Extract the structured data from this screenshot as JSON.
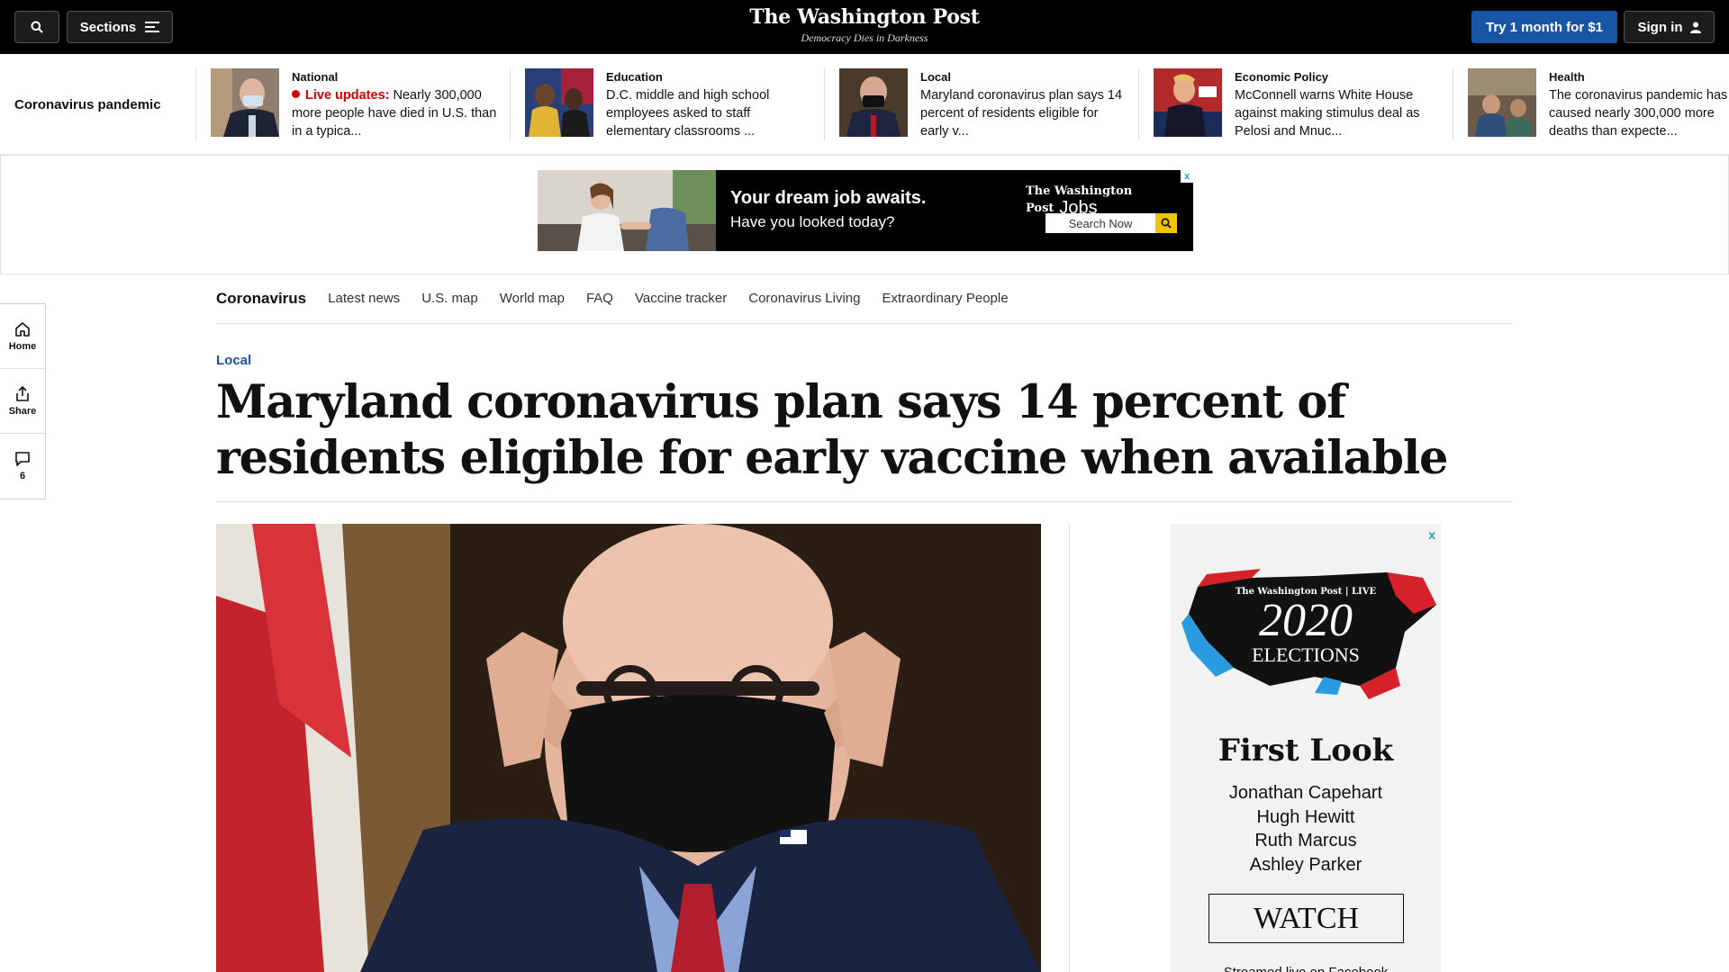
{
  "topbar": {
    "search_icon": "search-icon",
    "sections_label": "Sections",
    "logo": "The Washington Post",
    "tagline": "Democracy Dies in Darkness",
    "try_label": "Try 1 month for $1",
    "signin_label": "Sign in"
  },
  "strip": {
    "title": "Coronavirus pandemic",
    "stories": [
      {
        "kicker": "National",
        "live": "Live updates:",
        "headline": "Nearly 300,000 more people have died in U.S. than in a typica..."
      },
      {
        "kicker": "Education",
        "headline": "D.C. middle and high school employees asked to staff elementary classrooms ..."
      },
      {
        "kicker": "Local",
        "headline": "Maryland coronavirus plan says 14 percent of residents eligible for early v..."
      },
      {
        "kicker": "Economic Policy",
        "headline": "McConnell warns White House against making stimulus deal as Pelosi and Mnuc..."
      },
      {
        "kicker": "Health",
        "headline": "The coronavirus pandemic has caused nearly 300,000 more deaths than expecte..."
      }
    ]
  },
  "jobs_ad": {
    "headline": "Your dream job awaits.",
    "subline": "Have you looked today?",
    "logo": "The Washington Post",
    "logo_suffix": "Jobs",
    "search_label": "Search Now",
    "close": "x"
  },
  "subnav": {
    "brand": "Coronavirus",
    "items": [
      "Latest news",
      "U.S. map",
      "World map",
      "FAQ",
      "Vaccine tracker",
      "Coronavirus Living",
      "Extraordinary People"
    ]
  },
  "rail": {
    "home_label": "Home",
    "share_label": "Share",
    "comments_count": "6"
  },
  "article": {
    "section": "Local",
    "headline": "Maryland coronavirus plan says 14 percent of residents eligible for early vaccine when available"
  },
  "side_ad": {
    "close": "x",
    "brand": "The Washington Post | LIVE",
    "year": "2020",
    "elections": "ELECTIONS",
    "title": "First Look",
    "names": [
      "Jonathan Capehart",
      "Hugh Hewitt",
      "Ruth Marcus",
      "Ashley Parker"
    ],
    "watch_label": "WATCH",
    "more": "Streamed live on Facebook"
  }
}
